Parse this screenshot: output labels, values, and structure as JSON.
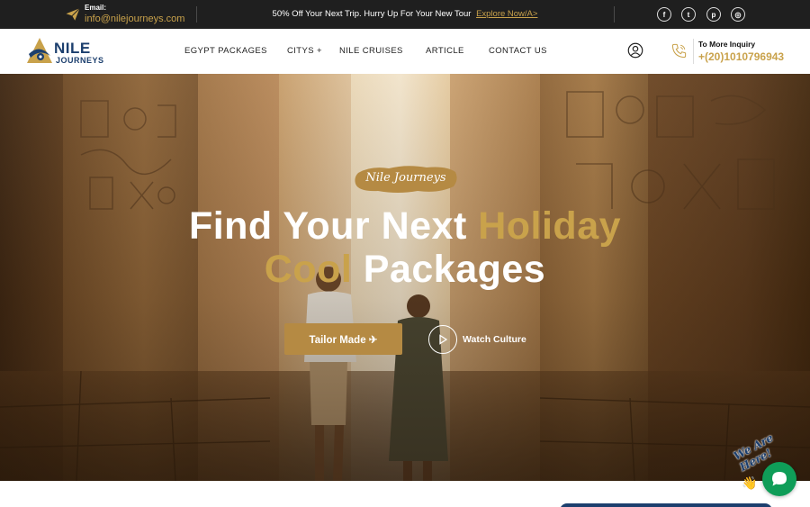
{
  "topbar": {
    "email_label": "Email:",
    "email_value": "info@nilejourneys.com",
    "promo_text": "50% Off Your Next Trip. Hurry Up For Your New Tour",
    "promo_link": "Explore Now/A>",
    "social": [
      {
        "name": "facebook-icon",
        "glyph": "f"
      },
      {
        "name": "twitter-icon",
        "glyph": "t"
      },
      {
        "name": "pinterest-icon",
        "glyph": "p"
      },
      {
        "name": "instagram-icon",
        "glyph": "◎"
      }
    ]
  },
  "header": {
    "logo_line1": "NILE",
    "logo_line2": "JOURNEYS",
    "nav": [
      {
        "label": "EGYPT PACKAGES"
      },
      {
        "label": "CITYS +"
      },
      {
        "label": "NILE CRUISES"
      },
      {
        "label": "ARTICLE"
      },
      {
        "label": "CONTACT US"
      }
    ],
    "inquiry_label": "To More Inquiry",
    "inquiry_phone": "+(20)1010796943"
  },
  "hero": {
    "badge": "Nile Journeys",
    "title_line1_white": "Find Your Next ",
    "title_line1_gold": "Holiday",
    "title_line2_gold": "Cool ",
    "title_line2_white": "Packages",
    "cta_label": "Tailor Made ✈",
    "video_label": "Watch Culture"
  },
  "chat": {
    "label": "We Are Here!"
  },
  "colors": {
    "accent_gold": "#c9a24b",
    "button_gold": "#b58a43",
    "brand_navy": "#1c3f6e",
    "topbar_bg": "#1f1f1f",
    "chat_green": "#0f9d58"
  }
}
